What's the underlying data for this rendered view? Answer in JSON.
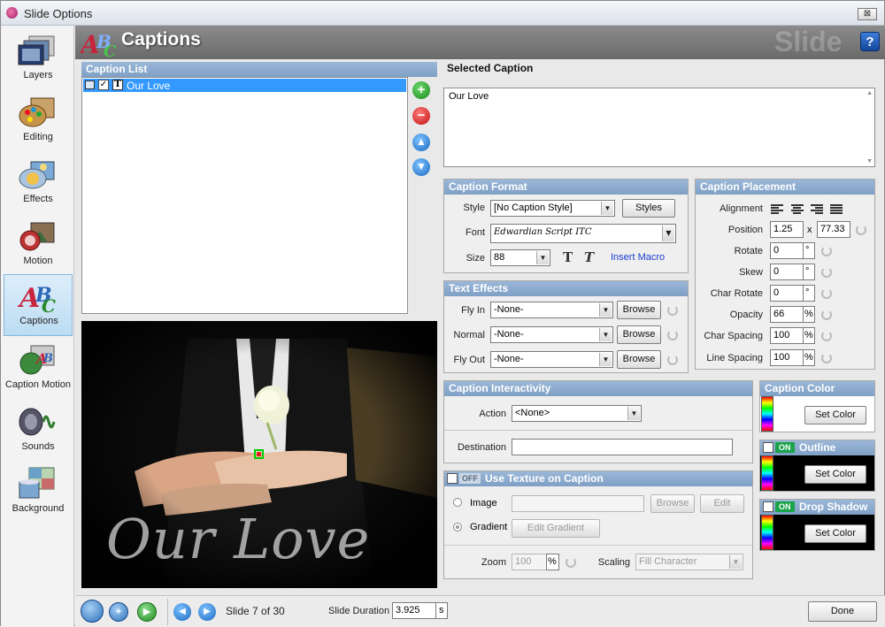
{
  "window": {
    "title": "Slide Options",
    "close_label": "⊠"
  },
  "nav": [
    {
      "label": "Layers",
      "icon": "layers-icon"
    },
    {
      "label": "Editing",
      "icon": "editing-icon"
    },
    {
      "label": "Effects",
      "icon": "effects-icon"
    },
    {
      "label": "Motion",
      "icon": "motion-icon"
    },
    {
      "label": "Captions",
      "icon": "captions-icon",
      "selected": true
    },
    {
      "label": "Caption Motion",
      "icon": "caption-motion-icon"
    },
    {
      "label": "Sounds",
      "icon": "sounds-icon"
    },
    {
      "label": "Background",
      "icon": "background-icon"
    }
  ],
  "header": {
    "title": "Captions",
    "watermark": "Slide",
    "help": "?"
  },
  "caption_list": {
    "title": "Caption List",
    "items": [
      {
        "text": "Our Love",
        "checked": true
      }
    ]
  },
  "selected_caption": {
    "title": "Selected Caption",
    "text": "Our Love"
  },
  "caption_format": {
    "title": "Caption Format",
    "style_label": "Style",
    "style_value": "[No Caption Style]",
    "styles_button": "Styles",
    "font_label": "Font",
    "font_value": "Edwardian Script ITC",
    "size_label": "Size",
    "size_value": "88",
    "bold_label": "T",
    "italic_label": "T",
    "insert_macro": "Insert Macro"
  },
  "text_effects": {
    "title": "Text Effects",
    "rows": [
      {
        "label": "Fly In",
        "value": "-None-",
        "button": "Browse"
      },
      {
        "label": "Normal",
        "value": "-None-",
        "button": "Browse"
      },
      {
        "label": "Fly Out",
        "value": "-None-",
        "button": "Browse"
      }
    ]
  },
  "caption_placement": {
    "title": "Caption Placement",
    "alignment_label": "Alignment",
    "position_label": "Position",
    "position_x": "1.25",
    "position_sep": "x",
    "position_y": "77.33",
    "rotate_label": "Rotate",
    "rotate_value": "0",
    "rotate_unit": "°",
    "skew_label": "Skew",
    "skew_value": "0",
    "skew_unit": "°",
    "char_rotate_label": "Char Rotate",
    "char_rotate_value": "0",
    "char_rotate_unit": "°",
    "opacity_label": "Opacity",
    "opacity_value": "66",
    "opacity_unit": "%",
    "char_spacing_label": "Char Spacing",
    "char_spacing_value": "100",
    "char_spacing_unit": "%",
    "line_spacing_label": "Line Spacing",
    "line_spacing_value": "100",
    "line_spacing_unit": "%"
  },
  "interactivity": {
    "title": "Caption Interactivity",
    "action_label": "Action",
    "action_value": "<None>",
    "destination_label": "Destination",
    "destination_value": ""
  },
  "texture": {
    "title": "Use Texture on Caption",
    "toggle": "OFF",
    "image_label": "Image",
    "image_value": "",
    "browse": "Browse",
    "edit": "Edit",
    "gradient_label": "Gradient",
    "edit_gradient": "Edit Gradient",
    "zoom_label": "Zoom",
    "zoom_value": "100",
    "zoom_unit": "%",
    "scaling_label": "Scaling",
    "scaling_value": "Fill Character"
  },
  "caption_color": {
    "title": "Caption Color",
    "button": "Set Color"
  },
  "outline": {
    "title": "Outline",
    "toggle": "ON",
    "button": "Set Color"
  },
  "drop_shadow": {
    "title": "Drop Shadow",
    "toggle": "ON",
    "button": "Set Color"
  },
  "preview": {
    "caption": "Our Love"
  },
  "footer": {
    "slide_info": "Slide 7 of 30",
    "duration_label": "Slide Duration",
    "duration_value": "3.925",
    "duration_unit": "s",
    "done": "Done"
  },
  "colors": {
    "panel_title": "#8eacd0",
    "selection": "#3399ff",
    "header": "#7a7a7a"
  }
}
